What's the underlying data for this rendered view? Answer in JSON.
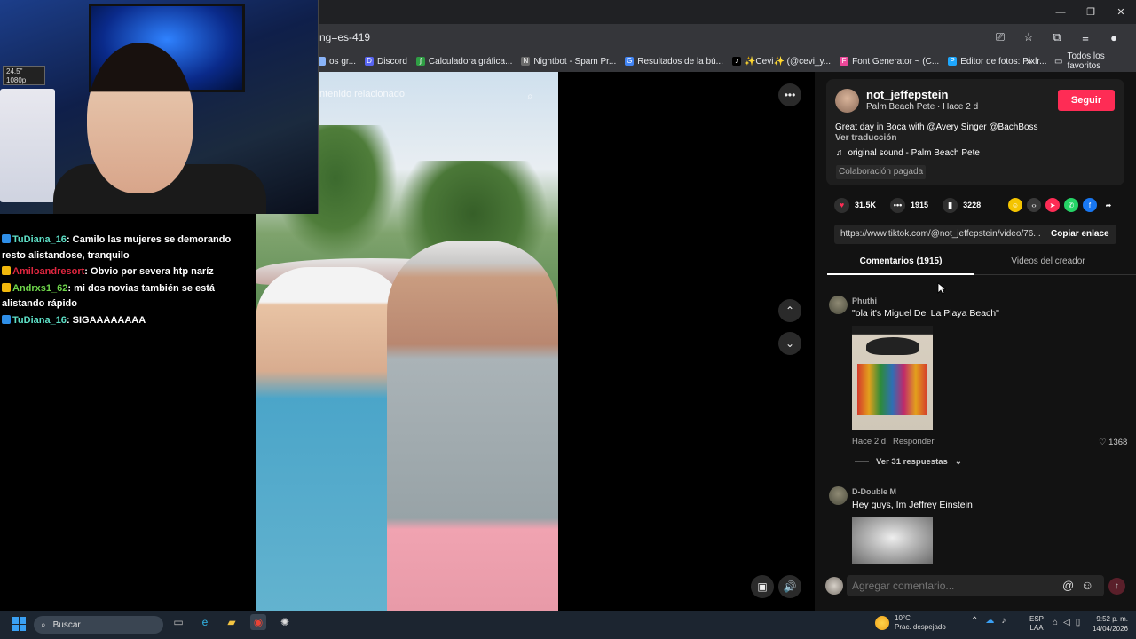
{
  "browser": {
    "url_partial": "ng=es-419",
    "bookmarks": [
      {
        "label": "os gr...",
        "color": "#8ab4f8",
        "glyph": ""
      },
      {
        "label": "Discord",
        "color": "#5865f2",
        "glyph": "D"
      },
      {
        "label": "Calculadora gráfica...",
        "color": "#2f9e44",
        "glyph": "∫"
      },
      {
        "label": "Nightbot - Spam Pr...",
        "color": "#6b6b6b",
        "glyph": "N"
      },
      {
        "label": "Resultados de la bú...",
        "color": "#4285f4",
        "glyph": "G"
      },
      {
        "label": "✨Cevi✨ (@cevi_y...",
        "color": "#000000",
        "glyph": "♪"
      },
      {
        "label": "Font Generator ~ (C...",
        "color": "#ec4899",
        "glyph": "F"
      },
      {
        "label": "Editor de fotos: Pixlr...",
        "color": "#1ea7fd",
        "glyph": "P"
      }
    ],
    "bookmarks_more": "»",
    "all_bookmarks": "Todos los favoritos"
  },
  "stream": {
    "webcam_overlay_text": "24.5\" 1080p",
    "chat": [
      {
        "user": "TuDiana_16",
        "user_color": "#5ee0c7",
        "message": ": Camilo las mujeres se demorando resto alistandose, tranquilo",
        "badge_color": "#2f8fe8"
      },
      {
        "user": "Amiloandresort",
        "user_color": "#e0263f",
        "message": ": Obvio por severa htp naríz",
        "badge_color": "#f2b80c"
      },
      {
        "user": "Andrxs1_62",
        "user_color": "#6fd64b",
        "message": ": mi dos novias también se está alistando rápido",
        "badge_color": "#f2b80c"
      },
      {
        "user": "TuDiana_16",
        "user_color": "#5ee0c7",
        "message": ": SIGAAAAAAAA",
        "badge_color": "#2f8fe8"
      }
    ]
  },
  "video": {
    "header": "ntenido relacionado"
  },
  "post": {
    "username": "not_jeffepstein",
    "subline": "Palm Beach Pete · Hace 2 d",
    "follow_label": "Seguir",
    "description": "Great day in Boca with @Avery Singer @BachBoss",
    "translate_label": "Ver traducción",
    "sound": "original sound - Palm Beach Pete",
    "paid_label": "Colaboración pagada",
    "likes": "31.5K",
    "comments": "1915",
    "saves": "3228",
    "link": "https://www.tiktok.com/@not_jeffepstein/video/76...",
    "copy_label": "Copiar enlace",
    "tab_comments": "Comentarios (1915)",
    "tab_videos": "Videos del creador"
  },
  "comments": [
    {
      "user": "Phuthi",
      "text": "\"ola it's Miguel Del La Playa Beach\"",
      "time": "Hace 2 d",
      "reply_label": "Responder",
      "likes": "1368",
      "view_replies": "Ver 31 respuestas"
    },
    {
      "user": "D-Double M",
      "text": "Hey guys, Im Jeffrey Einstein"
    }
  ],
  "comment_box": {
    "placeholder": "Agregar comentario..."
  },
  "taskbar": {
    "search_label": "Buscar",
    "temperature": "10°C",
    "weather_desc": "Prac. despejado",
    "lang1": "ESP",
    "lang2": "LAA",
    "time": "9:52 p. m.",
    "date": "14/04/2026"
  }
}
